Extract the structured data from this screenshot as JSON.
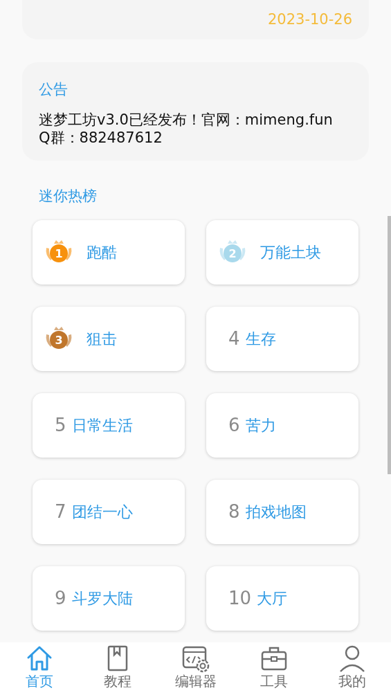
{
  "date_card": {
    "date": "2023-10-26"
  },
  "notice": {
    "title": "公告",
    "text": "迷梦工坊v3.0已经发布！官网：mimeng.fun　Q群：882487612"
  },
  "hot_list": {
    "title": "迷你热榜",
    "items": [
      {
        "kind": "medal",
        "rank": "1",
        "color": "#f7910d",
        "name": "跑酷"
      },
      {
        "kind": "medal",
        "rank": "2",
        "color": "#a9d9ec",
        "name": "万能土块"
      },
      {
        "kind": "medal",
        "rank": "3",
        "color": "#c0762c",
        "name": "狙击"
      },
      {
        "kind": "number",
        "rank": "4",
        "name": "生存"
      },
      {
        "kind": "number",
        "rank": "5",
        "name": "日常生活"
      },
      {
        "kind": "number",
        "rank": "6",
        "name": "苦力"
      },
      {
        "kind": "number",
        "rank": "7",
        "name": "团结一心"
      },
      {
        "kind": "number",
        "rank": "8",
        "name": "拍戏地图"
      },
      {
        "kind": "number",
        "rank": "9",
        "name": "斗罗大陆"
      },
      {
        "kind": "number",
        "rank": "10",
        "name": "大厅"
      }
    ]
  },
  "bottom_nav": [
    {
      "kind": "home",
      "label": "首页",
      "selected": true
    },
    {
      "kind": "book",
      "label": "教程",
      "selected": false
    },
    {
      "kind": "editor",
      "label": "编辑器",
      "selected": false
    },
    {
      "kind": "toolbox",
      "label": "工具",
      "selected": false
    },
    {
      "kind": "user",
      "label": "我的",
      "selected": false
    }
  ]
}
